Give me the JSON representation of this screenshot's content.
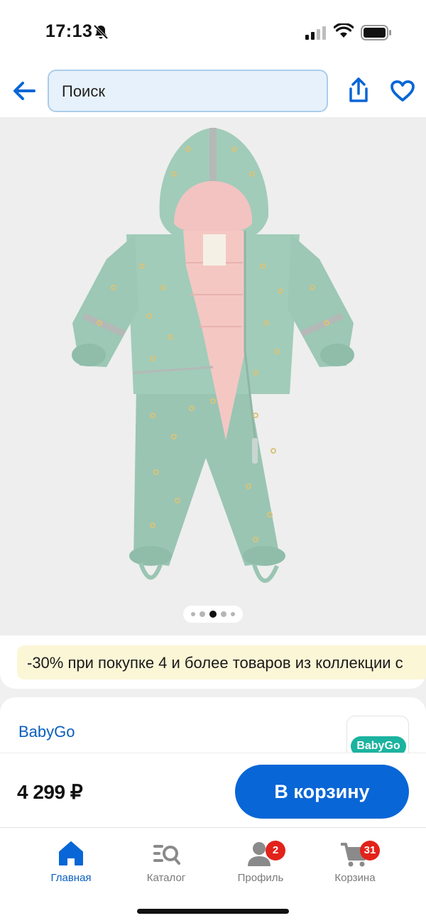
{
  "status_bar": {
    "time": "17:13"
  },
  "header": {
    "search_placeholder": "Поиск"
  },
  "gallery": {
    "image_count": 5,
    "active_index": 2
  },
  "promo": {
    "text": "-30% при покупке 4 и более товаров из коллекции с"
  },
  "brand": {
    "name": "BabyGo",
    "logo_text": "BabyGo"
  },
  "buy_bar": {
    "price": "4 299 ₽",
    "cart_button_label": "В корзину"
  },
  "tabs": [
    {
      "label": "Главная",
      "icon": "home-icon",
      "active": true
    },
    {
      "label": "Каталог",
      "icon": "catalog-icon",
      "active": false
    },
    {
      "label": "Профиль",
      "icon": "profile-icon",
      "badge": "2",
      "active": false
    },
    {
      "label": "Корзина",
      "icon": "cart-icon",
      "badge": "31",
      "active": false
    }
  ],
  "colors": {
    "accent": "#0866d6",
    "badge": "#e2231a",
    "promo_bg": "#fbf6d6",
    "brand_logo": "#1bb39f"
  }
}
